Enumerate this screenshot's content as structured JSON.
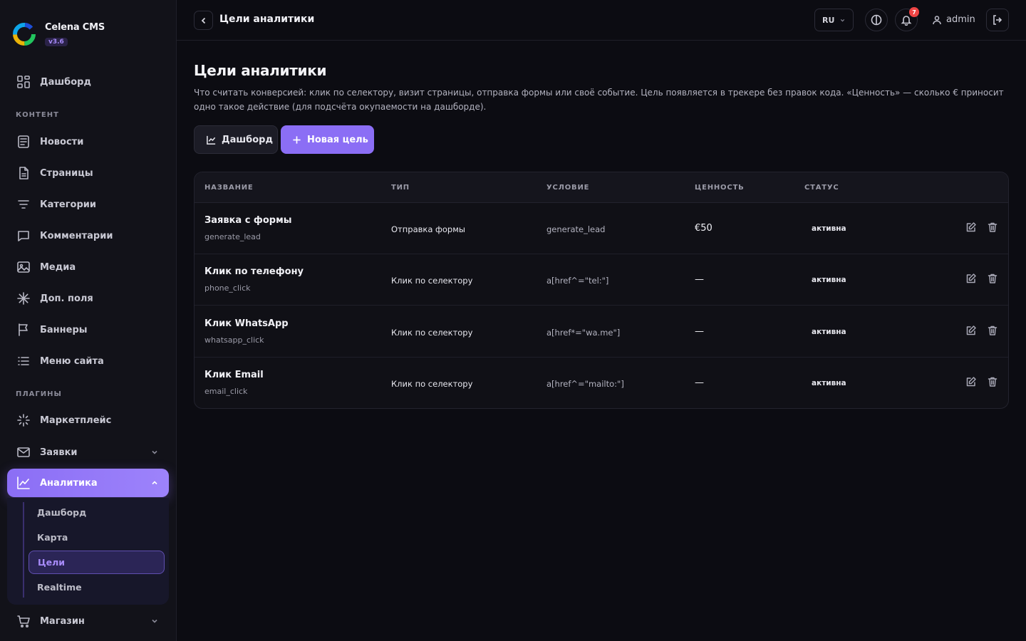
{
  "app": {
    "name": "Celena CMS",
    "version": "v3.6"
  },
  "sidebar": {
    "dashboard": "Дашборд",
    "section_content": "КОНТЕНТ",
    "content_items": [
      {
        "label": "Новости",
        "icon": "news-icon"
      },
      {
        "label": "Страницы",
        "icon": "pages-icon"
      },
      {
        "label": "Категории",
        "icon": "categories-icon"
      },
      {
        "label": "Комментарии",
        "icon": "comments-icon"
      },
      {
        "label": "Медиа",
        "icon": "media-icon"
      },
      {
        "label": "Доп. поля",
        "icon": "fields-icon"
      },
      {
        "label": "Баннеры",
        "icon": "banners-icon"
      },
      {
        "label": "Меню сайта",
        "icon": "menu-icon"
      }
    ],
    "section_plugins": "ПЛАГИНЫ",
    "plugin_items": [
      {
        "label": "Маркетплейс",
        "icon": "marketplace-icon"
      },
      {
        "label": "Заявки",
        "icon": "mail-icon"
      },
      {
        "label": "Аналитика",
        "icon": "analytics-icon"
      }
    ],
    "analytics_sub": [
      "Дашборд",
      "Карта",
      "Цели",
      "Realtime"
    ],
    "shop": "Магазин"
  },
  "header": {
    "title": "Цели аналитики",
    "lang": "RU",
    "notifications": "7",
    "user": "admin"
  },
  "main": {
    "title": "Цели аналитики",
    "description": "Что считать конверсией: клик по селектору, визит страницы, отправка формы или своё событие. Цель появляется в трекере без правок кода. «Ценность» — сколько € приносит одно такое действие (для подсчёта окупаемости на дашборде).",
    "btn_dashboard": "Дашборд",
    "btn_new": "Новая цель"
  },
  "table": {
    "headers": [
      "НАЗВАНИЕ",
      "ТИП",
      "УСЛОВИЕ",
      "ЦЕННОСТЬ",
      "СТАТУС"
    ],
    "rows": [
      {
        "name": "Заявка с формы",
        "key": "generate_lead",
        "type": "Отправка формы",
        "condition": "generate_lead",
        "value": "€50",
        "status": "активна"
      },
      {
        "name": "Клик по телефону",
        "key": "phone_click",
        "type": "Клик по селектору",
        "condition": "a[href^=\"tel:\"]",
        "value": "—",
        "status": "активна"
      },
      {
        "name": "Клик WhatsApp",
        "key": "whatsapp_click",
        "type": "Клик по селектору",
        "condition": "a[href*=\"wa.me\"]",
        "value": "—",
        "status": "активна"
      },
      {
        "name": "Клик Email",
        "key": "email_click",
        "type": "Клик по селектору",
        "condition": "a[href^=\"mailto:\"]",
        "value": "—",
        "status": "активна"
      }
    ]
  }
}
